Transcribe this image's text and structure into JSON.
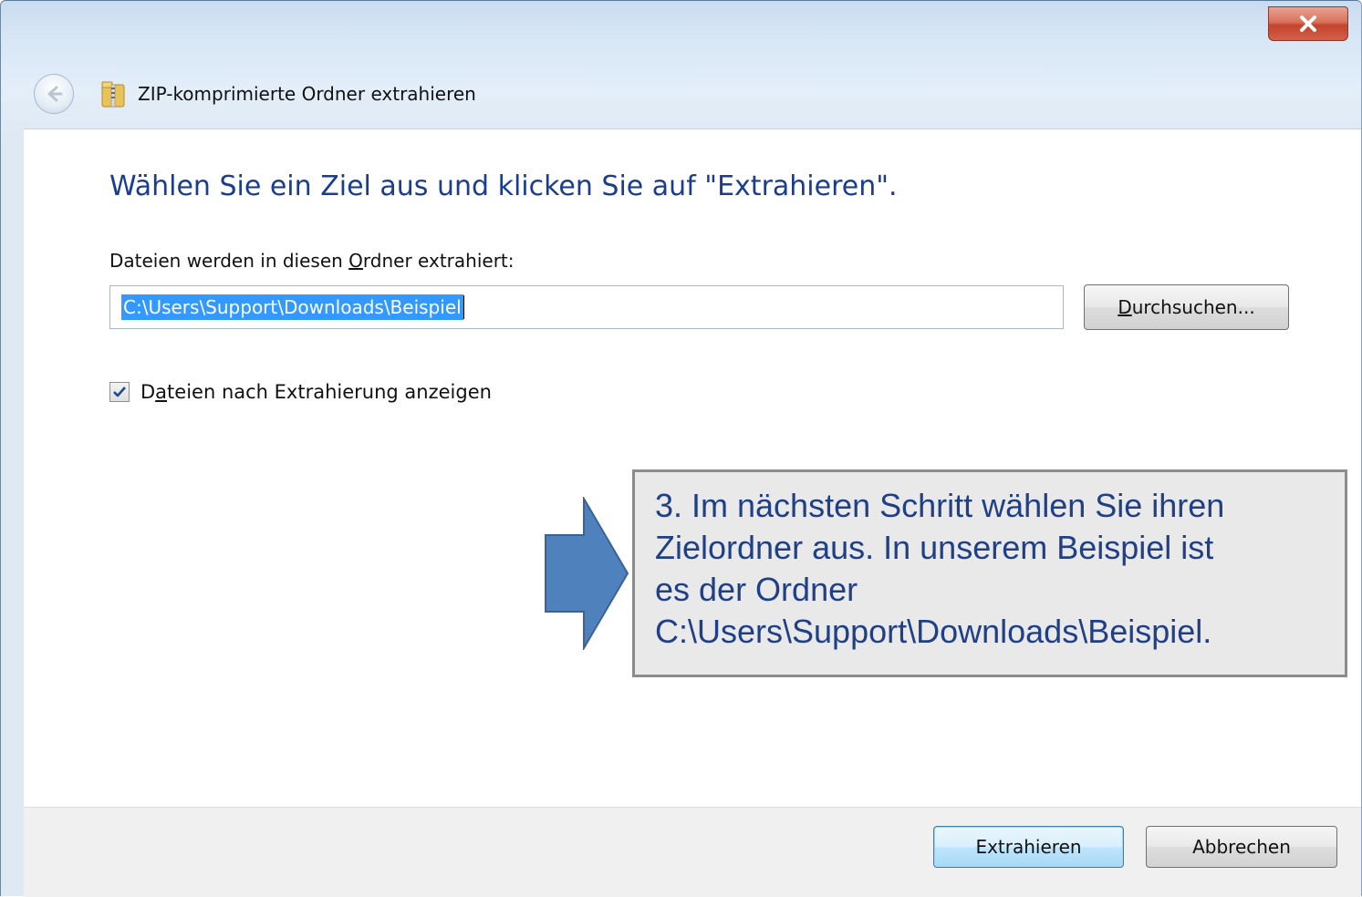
{
  "window": {
    "title": "ZIP-komprimierte Ordner extrahieren",
    "close_label": "X",
    "icons": {
      "back": "back-arrow-icon",
      "zip": "zip-folder-icon",
      "close": "close-icon"
    }
  },
  "dialog": {
    "heading": "Wählen Sie ein Ziel aus und klicken Sie auf \"Extrahieren\".",
    "field_label_prefix": "Dateien werden in diesen ",
    "field_label_accel": "O",
    "field_label_suffix": "rdner extrahiert:",
    "path_value": "C:\\Users\\Support\\Downloads\\Beispiel",
    "browse_accel": "D",
    "browse_rest": "urchsuchen...",
    "checkbox": {
      "checked": true,
      "label_prefix": "D",
      "label_accel": "a",
      "label_suffix": "teien nach Extrahierung anzeigen"
    }
  },
  "footer": {
    "extract_label": "Extrahieren",
    "cancel_label": "Abbrechen"
  },
  "annotation": {
    "lines": [
      "3. Im nächsten Schritt wählen Sie ihren",
      "Zielordner aus. In unserem Beispiel ist",
      "es der Ordner",
      "C:\\Users\\Support\\Downloads\\Beispiel."
    ],
    "arrow_color": "#4f81bd",
    "box_color": "#e9e9e9",
    "text_color": "#1f3f86"
  },
  "colors": {
    "heading": "#1a3d8f",
    "selection": "#3399ff"
  }
}
